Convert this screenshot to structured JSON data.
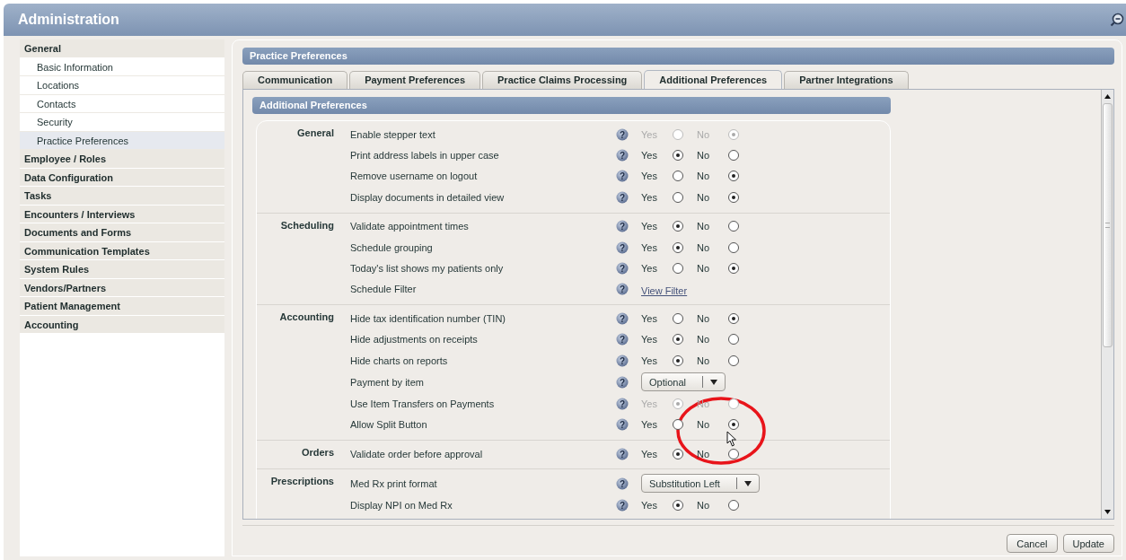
{
  "window": {
    "title": "Administration"
  },
  "sidebar": {
    "items": [
      {
        "label": "General",
        "selected": false,
        "children": [
          {
            "label": "Basic Information",
            "selected": false
          },
          {
            "label": "Locations",
            "selected": false
          },
          {
            "label": "Contacts",
            "selected": false
          },
          {
            "label": "Security",
            "selected": false
          },
          {
            "label": "Practice Preferences",
            "selected": true
          }
        ]
      },
      {
        "label": "Employee / Roles",
        "selected": false
      },
      {
        "label": "Data Configuration",
        "selected": false
      },
      {
        "label": "Tasks",
        "selected": false
      },
      {
        "label": "Encounters / Interviews",
        "selected": false
      },
      {
        "label": "Documents and Forms",
        "selected": false
      },
      {
        "label": "Communication Templates",
        "selected": false
      },
      {
        "label": "System Rules",
        "selected": false
      },
      {
        "label": "Vendors/Partners",
        "selected": false
      },
      {
        "label": "Patient Management",
        "selected": false
      },
      {
        "label": "Accounting",
        "selected": false
      }
    ]
  },
  "panel": {
    "title": "Practice Preferences",
    "tabs": [
      {
        "label": "Communication",
        "selected": false
      },
      {
        "label": "Payment Preferences",
        "selected": false
      },
      {
        "label": "Practice Claims Processing",
        "selected": false
      },
      {
        "label": "Additional Preferences",
        "selected": true
      },
      {
        "label": "Partner Integrations",
        "selected": false
      }
    ],
    "section_title": "Additional Preferences",
    "groups": [
      {
        "label": "General",
        "rows": [
          {
            "kind": "radio",
            "help": "?",
            "label": "Enable stepper text",
            "disabled": true,
            "options": [
              {
                "label": "Yes",
                "selected": false
              },
              {
                "label": "No",
                "selected": true
              }
            ]
          },
          {
            "kind": "radio",
            "help": "?",
            "label": "Print address labels in upper case",
            "disabled": false,
            "options": [
              {
                "label": "Yes",
                "selected": true
              },
              {
                "label": "No",
                "selected": false
              }
            ]
          },
          {
            "kind": "radio",
            "help": "?",
            "label": "Remove username on logout",
            "disabled": false,
            "options": [
              {
                "label": "Yes",
                "selected": false
              },
              {
                "label": "No",
                "selected": true
              }
            ]
          },
          {
            "kind": "radio",
            "help": "?",
            "label": "Display documents in detailed view",
            "disabled": false,
            "options": [
              {
                "label": "Yes",
                "selected": false
              },
              {
                "label": "No",
                "selected": true
              }
            ]
          }
        ]
      },
      {
        "label": "Scheduling",
        "rows": [
          {
            "kind": "radio",
            "help": "?",
            "label": "Validate appointment times",
            "disabled": false,
            "options": [
              {
                "label": "Yes",
                "selected": true
              },
              {
                "label": "No",
                "selected": false
              }
            ]
          },
          {
            "kind": "radio",
            "help": "?",
            "label": "Schedule grouping",
            "disabled": false,
            "options": [
              {
                "label": "Yes",
                "selected": true
              },
              {
                "label": "No",
                "selected": false
              }
            ]
          },
          {
            "kind": "radio",
            "help": "?",
            "label": "Today's list shows my patients only",
            "disabled": false,
            "options": [
              {
                "label": "Yes",
                "selected": false
              },
              {
                "label": "No",
                "selected": true
              }
            ]
          },
          {
            "kind": "link",
            "help": "?",
            "label": "Schedule Filter",
            "link": "View Filter"
          }
        ]
      },
      {
        "label": "Accounting",
        "rows": [
          {
            "kind": "radio",
            "help": "?",
            "label": "Hide tax identification number (TIN)",
            "disabled": false,
            "options": [
              {
                "label": "Yes",
                "selected": false
              },
              {
                "label": "No",
                "selected": true
              }
            ]
          },
          {
            "kind": "radio",
            "help": "?",
            "label": "Hide adjustments on receipts",
            "disabled": false,
            "options": [
              {
                "label": "Yes",
                "selected": true
              },
              {
                "label": "No",
                "selected": false
              }
            ]
          },
          {
            "kind": "radio",
            "help": "?",
            "label": "Hide charts on reports",
            "disabled": false,
            "options": [
              {
                "label": "Yes",
                "selected": true
              },
              {
                "label": "No",
                "selected": false
              }
            ]
          },
          {
            "kind": "select",
            "help": "?",
            "label": "Payment by item",
            "value": "Optional"
          },
          {
            "kind": "radio",
            "help": "?",
            "label": "Use Item Transfers on Payments",
            "disabled": true,
            "options": [
              {
                "label": "Yes",
                "selected": true
              },
              {
                "label": "No",
                "selected": false
              }
            ]
          },
          {
            "kind": "radio",
            "help": "?",
            "label": "Allow Split Button",
            "disabled": false,
            "options": [
              {
                "label": "Yes",
                "selected": false
              },
              {
                "label": "No",
                "selected": true
              }
            ]
          }
        ]
      },
      {
        "label": "Orders",
        "rows": [
          {
            "kind": "radio",
            "help": "?",
            "label": "Validate order before approval",
            "disabled": false,
            "options": [
              {
                "label": "Yes",
                "selected": true
              },
              {
                "label": "No",
                "selected": false
              }
            ]
          }
        ]
      },
      {
        "label": "Prescriptions",
        "rows": [
          {
            "kind": "select",
            "help": "?",
            "label": "Med Rx print format",
            "value": "Substitution Left"
          },
          {
            "kind": "radio",
            "help": "?",
            "label": "Display NPI on Med Rx",
            "disabled": false,
            "options": [
              {
                "label": "Yes",
                "selected": true
              },
              {
                "label": "No",
                "selected": false
              }
            ]
          }
        ]
      }
    ]
  },
  "buttons": [
    "Cancel",
    "Update"
  ]
}
